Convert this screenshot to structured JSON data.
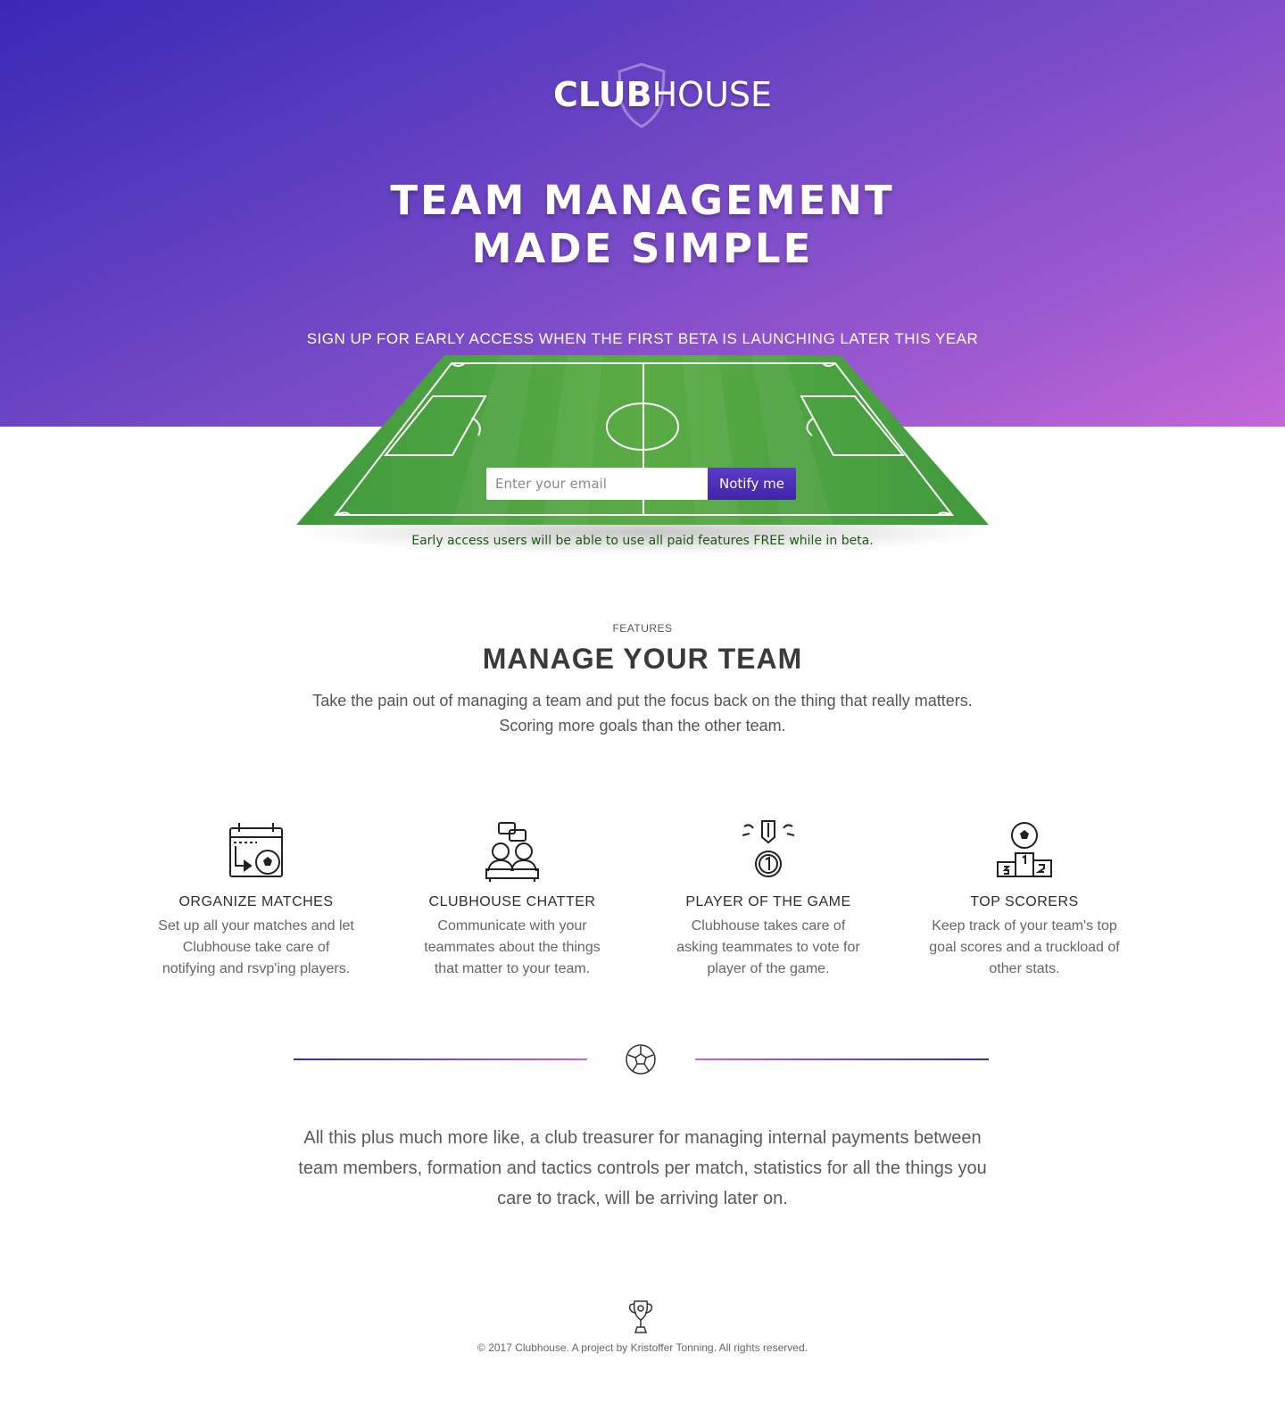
{
  "brand": {
    "logo_text_bold": "CLUB",
    "logo_text_light": "HOUSE",
    "logo_icon": "shield-icon"
  },
  "hero": {
    "title_line1": "TEAM MANAGEMENT",
    "title_line2": "MADE SIMPLE",
    "subtitle": "SIGN UP FOR EARLY ACCESS WHEN THE FIRST BETA IS LAUNCHING LATER THIS YEAR",
    "gradient_start": "#3a28b5",
    "gradient_end": "#c466d8"
  },
  "signup": {
    "email_placeholder": "Enter your email",
    "email_value": "",
    "button_label": "Notify me",
    "note": "Early access users will be able to use all paid features FREE while in beta.",
    "pitch_color": "#45a043",
    "button_color": "#4a2eb8"
  },
  "features": {
    "label": "FEATURES",
    "title": "MANAGE YOUR TEAM",
    "description_line1": "Take the pain out of managing a team and put the focus back on the thing that really matters.",
    "description_line2": "Scoring more goals than the other team.",
    "items": [
      {
        "icon": "calendar-ball-icon",
        "title": "ORGANIZE MATCHES",
        "text": "Set up all your matches and let Clubhouse take care of notifying and rsvp'ing players."
      },
      {
        "icon": "chat-players-icon",
        "title": "CLUBHOUSE CHATTER",
        "text": "Communicate with your teammates about the things that matter to your team."
      },
      {
        "icon": "medal-icon",
        "title": "PLAYER OF THE GAME",
        "text": "Clubhouse takes care of asking teammates to vote for player of the game."
      },
      {
        "icon": "podium-icon",
        "title": "TOP SCORERS",
        "text": "Keep track of your team's top goal scores and a truckload of other stats."
      }
    ]
  },
  "divider": {
    "icon": "soccer-ball-icon"
  },
  "more": {
    "text": "All this plus much more like, a club treasurer for managing internal payments between team members, formation and tactics controls per match, statistics for all the things you care to track, will be arriving later on."
  },
  "footer": {
    "icon": "trophy-icon",
    "copyright": "© 2017 Clubhouse. A project by Kristoffer Tonning. All rights reserved."
  }
}
